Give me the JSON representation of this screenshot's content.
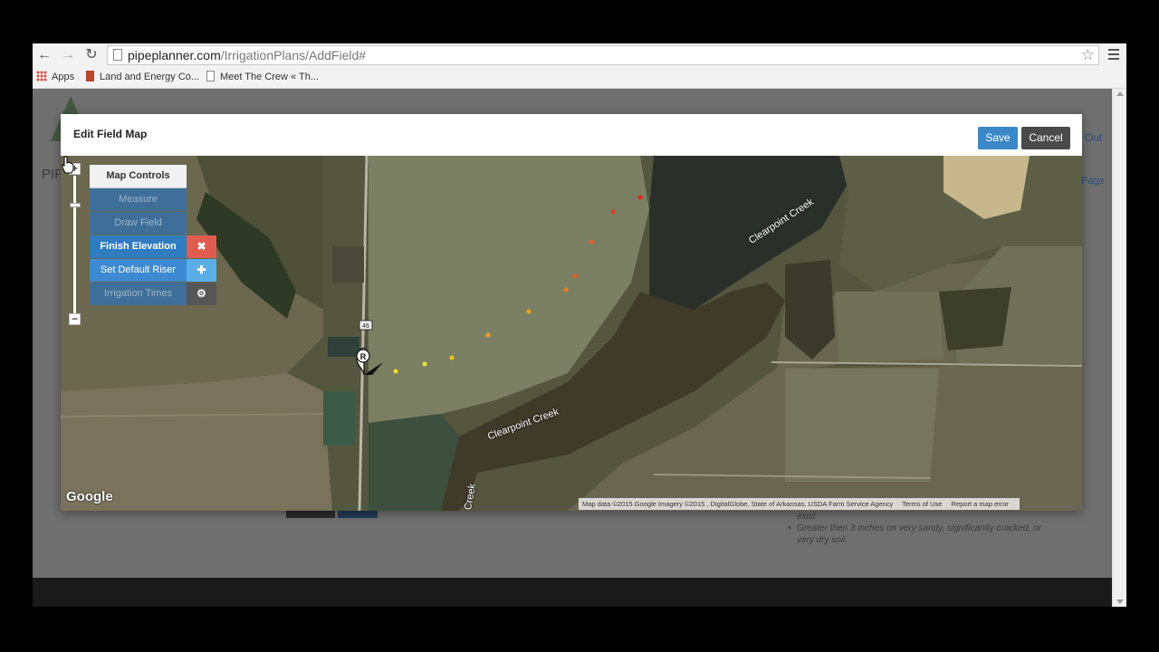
{
  "browser": {
    "url_host": "pipeplanner.com",
    "url_path": "/IrrigationPlans/AddField#",
    "bookmarks": [
      {
        "label": "Apps"
      },
      {
        "label": "Land and Energy Co..."
      },
      {
        "label": "Meet The Crew « Th..."
      }
    ]
  },
  "background": {
    "logo_text": "PIP",
    "signout": "Out",
    "page_link": "Page",
    "list_items": [
      "exist",
      "Greater then 3 inches on very sandy, significantly cracked, or very dry soil."
    ]
  },
  "modal": {
    "title": "Edit Field Map",
    "save_label": "Save",
    "cancel_label": "Cancel"
  },
  "map_controls": {
    "header": "Map Controls",
    "measure": "Measure",
    "draw_field": "Draw Field",
    "finish_elevation": "Finish Elevation",
    "finish_elevation_close": "✖",
    "set_default_riser": "Set Default Riser",
    "set_default_riser_add": "✚",
    "irrigation_times": "Irrigation Times",
    "irrigation_times_icon": "⚙"
  },
  "zoom": {
    "plus": "+",
    "minus": "−"
  },
  "map": {
    "labels": {
      "creek_top": "Clearpoint Creek",
      "creek_bottom": "Clearpoint Creek",
      "creek_vertical": "Creek",
      "road_shield": "46",
      "riser_marker": "R"
    },
    "google_logo": "Google",
    "attribution": "Map data ©2015 Google Imagery ©2015 , DigitalGlobe, State of Arkansas, USDA Farm Service Agency",
    "terms": "Terms of Use",
    "report": "Report a map error",
    "elevation_point_colors": [
      "#f0dd30",
      "#f2c028",
      "#f0a020",
      "#ee7c1c",
      "#ea5a18",
      "#e63a16",
      "#e22414"
    ]
  }
}
